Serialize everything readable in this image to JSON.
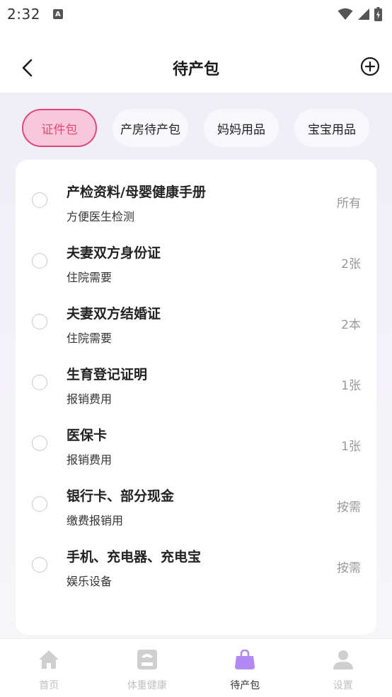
{
  "status_bar": {
    "time": "2:32",
    "notification_letter": "A"
  },
  "header": {
    "title": "待产包"
  },
  "tabs": [
    {
      "label": "证件包",
      "active": true
    },
    {
      "label": "产房待产包",
      "active": false
    },
    {
      "label": "妈妈用品",
      "active": false
    },
    {
      "label": "宝宝用品",
      "active": false
    }
  ],
  "items": [
    {
      "name": "产检资料/母婴健康手册",
      "desc": "方便医生检测",
      "qty": "所有"
    },
    {
      "name": "夫妻双方身份证",
      "desc": "住院需要",
      "qty": "2张"
    },
    {
      "name": "夫妻双方结婚证",
      "desc": "住院需要",
      "qty": "2本"
    },
    {
      "name": "生育登记证明",
      "desc": "报销费用",
      "qty": "1张"
    },
    {
      "name": "医保卡",
      "desc": "报销费用",
      "qty": "1张"
    },
    {
      "name": "银行卡、部分现金",
      "desc": "缴费报销用",
      "qty": "按需"
    },
    {
      "name": "手机、充电器、充电宝",
      "desc": "娱乐设备",
      "qty": "按需"
    }
  ],
  "bottom_nav": [
    {
      "label": "首页",
      "icon": "home-icon",
      "active": false
    },
    {
      "label": "体重健康",
      "icon": "scale-icon",
      "active": false
    },
    {
      "label": "待产包",
      "icon": "bag-icon",
      "active": true
    },
    {
      "label": "设置",
      "icon": "person-icon",
      "active": false
    }
  ],
  "colors": {
    "accent_pink": "#e2477c",
    "tab_active_bg": "#f6c8d9",
    "nav_active": "#b18af3",
    "nav_inactive": "#cfcfcf"
  }
}
